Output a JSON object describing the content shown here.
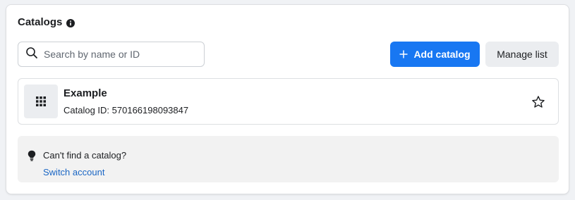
{
  "section": {
    "title": "Catalogs"
  },
  "search": {
    "placeholder": "Search by name or ID",
    "value": ""
  },
  "actions": {
    "add_catalog_label": "Add catalog",
    "manage_list_label": "Manage list"
  },
  "catalogs": [
    {
      "name": "Example",
      "id_text": "Catalog ID: 570166198093847",
      "favorited": false
    }
  ],
  "notice": {
    "text": "Can't find a catalog?",
    "link_label": "Switch account"
  },
  "colors": {
    "primary": "#1877f2",
    "link": "#1a66c4",
    "text": "#1c1e21",
    "notice_bg": "#f2f2f2"
  },
  "icons": {
    "info": "info-icon",
    "search": "search-icon",
    "add": "plus-icon",
    "catalog": "grid-icon",
    "favorite": "star-icon",
    "hint": "lightbulb-icon"
  }
}
